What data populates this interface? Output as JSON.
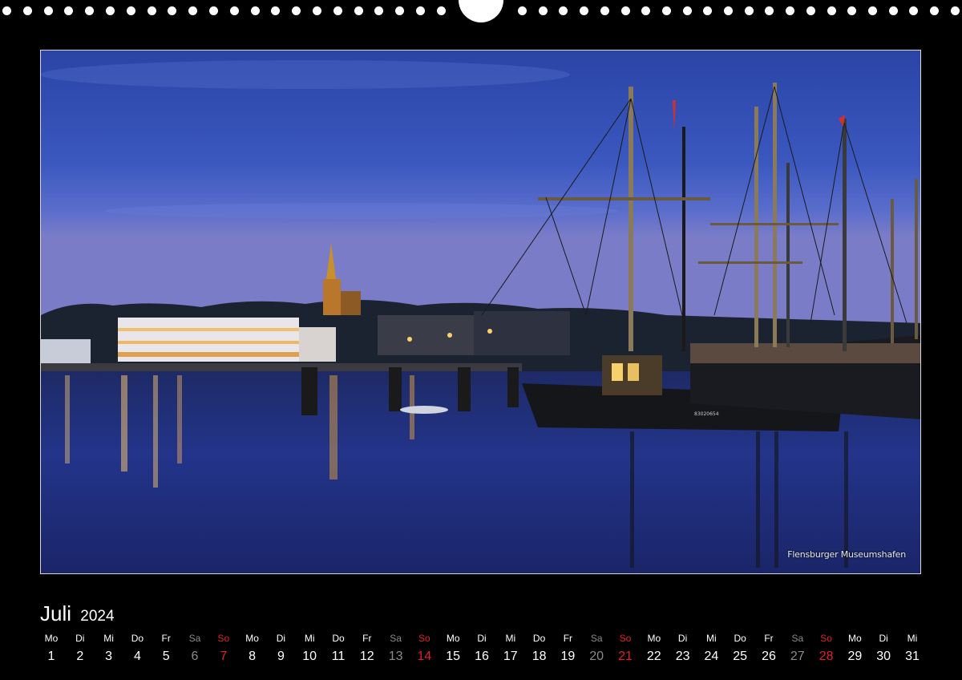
{
  "photo": {
    "caption": "Flensburger Museumshafen",
    "boat_registration": "83020654"
  },
  "calendar": {
    "month": "Juli",
    "year": "2024",
    "days": [
      {
        "wd": "Mo",
        "d": "1",
        "type": "weekday"
      },
      {
        "wd": "Di",
        "d": "2",
        "type": "weekday"
      },
      {
        "wd": "Mi",
        "d": "3",
        "type": "weekday"
      },
      {
        "wd": "Do",
        "d": "4",
        "type": "weekday"
      },
      {
        "wd": "Fr",
        "d": "5",
        "type": "weekday"
      },
      {
        "wd": "Sa",
        "d": "6",
        "type": "sat"
      },
      {
        "wd": "So",
        "d": "7",
        "type": "sun"
      },
      {
        "wd": "Mo",
        "d": "8",
        "type": "weekday"
      },
      {
        "wd": "Di",
        "d": "9",
        "type": "weekday"
      },
      {
        "wd": "Mi",
        "d": "10",
        "type": "weekday"
      },
      {
        "wd": "Do",
        "d": "11",
        "type": "weekday"
      },
      {
        "wd": "Fr",
        "d": "12",
        "type": "weekday"
      },
      {
        "wd": "Sa",
        "d": "13",
        "type": "sat"
      },
      {
        "wd": "So",
        "d": "14",
        "type": "sun"
      },
      {
        "wd": "Mo",
        "d": "15",
        "type": "weekday"
      },
      {
        "wd": "Di",
        "d": "16",
        "type": "weekday"
      },
      {
        "wd": "Mi",
        "d": "17",
        "type": "weekday"
      },
      {
        "wd": "Do",
        "d": "18",
        "type": "weekday"
      },
      {
        "wd": "Fr",
        "d": "19",
        "type": "weekday"
      },
      {
        "wd": "Sa",
        "d": "20",
        "type": "sat"
      },
      {
        "wd": "So",
        "d": "21",
        "type": "sun"
      },
      {
        "wd": "Mo",
        "d": "22",
        "type": "weekday"
      },
      {
        "wd": "Di",
        "d": "23",
        "type": "weekday"
      },
      {
        "wd": "Mi",
        "d": "24",
        "type": "weekday"
      },
      {
        "wd": "Do",
        "d": "25",
        "type": "weekday"
      },
      {
        "wd": "Fr",
        "d": "26",
        "type": "weekday"
      },
      {
        "wd": "Sa",
        "d": "27",
        "type": "sat"
      },
      {
        "wd": "So",
        "d": "28",
        "type": "sun"
      },
      {
        "wd": "Mo",
        "d": "29",
        "type": "weekday"
      },
      {
        "wd": "Di",
        "d": "30",
        "type": "weekday"
      },
      {
        "wd": "Mi",
        "d": "31",
        "type": "weekday"
      }
    ]
  },
  "colors": {
    "background": "#000000",
    "sunday": "#e0202a",
    "saturday": "#8a8a8a",
    "text": "#ffffff"
  }
}
